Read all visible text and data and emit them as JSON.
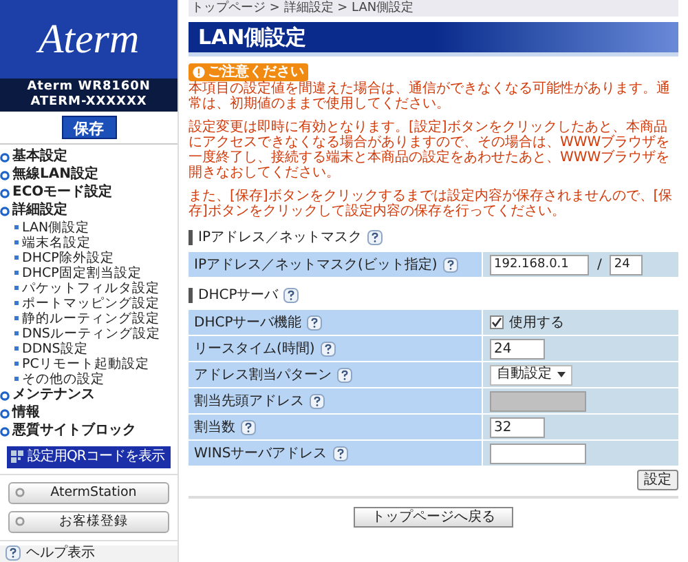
{
  "sidebar": {
    "logo": "Aterm",
    "model": "Aterm WR8160N",
    "device": "ATERM-XXXXXX",
    "save_button": "保存",
    "menu": [
      {
        "label": "基本設定"
      },
      {
        "label": "無線LAN設定"
      },
      {
        "label": "ECOモード設定"
      },
      {
        "label": "詳細設定",
        "children": [
          {
            "label": "LAN側設定"
          },
          {
            "label": "端末名設定"
          },
          {
            "label": "DHCP除外設定"
          },
          {
            "label": "DHCP固定割当設定"
          },
          {
            "label": "パケットフィルタ設定"
          },
          {
            "label": "ポートマッピング設定"
          },
          {
            "label": "静的ルーティング設定"
          },
          {
            "label": "DNSルーティング設定"
          },
          {
            "label": "DDNS設定"
          },
          {
            "label": "PCリモート起動設定"
          },
          {
            "label": "その他の設定"
          }
        ]
      },
      {
        "label": "メンテナンス"
      },
      {
        "label": "情報"
      },
      {
        "label": "悪質サイトブロック"
      }
    ],
    "qr_button": "設定用QRコードを表示",
    "link_buttons": [
      "AtermStation",
      "お客様登録"
    ],
    "help": "ヘルプ表示"
  },
  "breadcrumb": "トップページ > 詳細設定 > LAN側設定",
  "page_title": "LAN側設定",
  "notice": {
    "badge": "ご注意ください",
    "paragraphs": [
      "本項目の設定値を間違えた場合は、通信ができなくなる可能性があります。通常は、初期値のままで使用してください。",
      "設定変更は即時に有効となります。[設定]ボタンをクリックしたあと、本商品にアクセスできなくなる場合がありますので、その場合は、WWWブラウザを一度終了し、接続する端末と本商品の設定をあわせたあと、WWWブラウザを開きなおしてください。",
      "また、[保存]ボタンをクリックするまでは設定内容が保存されませんので、[保存]ボタンをクリックして設定内容の保存を行ってください。"
    ]
  },
  "sections": [
    {
      "title": "IPアドレス／ネットマスク",
      "rows": [
        {
          "label": "IPアドレス／ネットマスク(ビット指定)",
          "kind": "ip",
          "value": "192.168.0.1",
          "separator": "/",
          "mask": "24"
        }
      ]
    },
    {
      "title": "DHCPサーバ",
      "rows": [
        {
          "label": "DHCPサーバ機能",
          "kind": "checkbox",
          "checked": true,
          "text": "使用する"
        },
        {
          "label": "リースタイム(時間)",
          "kind": "short",
          "value": "24"
        },
        {
          "label": "アドレス割当パターン",
          "kind": "select",
          "value": "自動設定"
        },
        {
          "label": "割当先頭アドレス",
          "kind": "long",
          "disabled": true
        },
        {
          "label": "割当数",
          "kind": "short",
          "value": "32"
        },
        {
          "label": "WINSサーバアドレス",
          "kind": "long",
          "disabled": false
        }
      ]
    }
  ],
  "set_button": "設定",
  "back_button": "トップページへ戻る"
}
